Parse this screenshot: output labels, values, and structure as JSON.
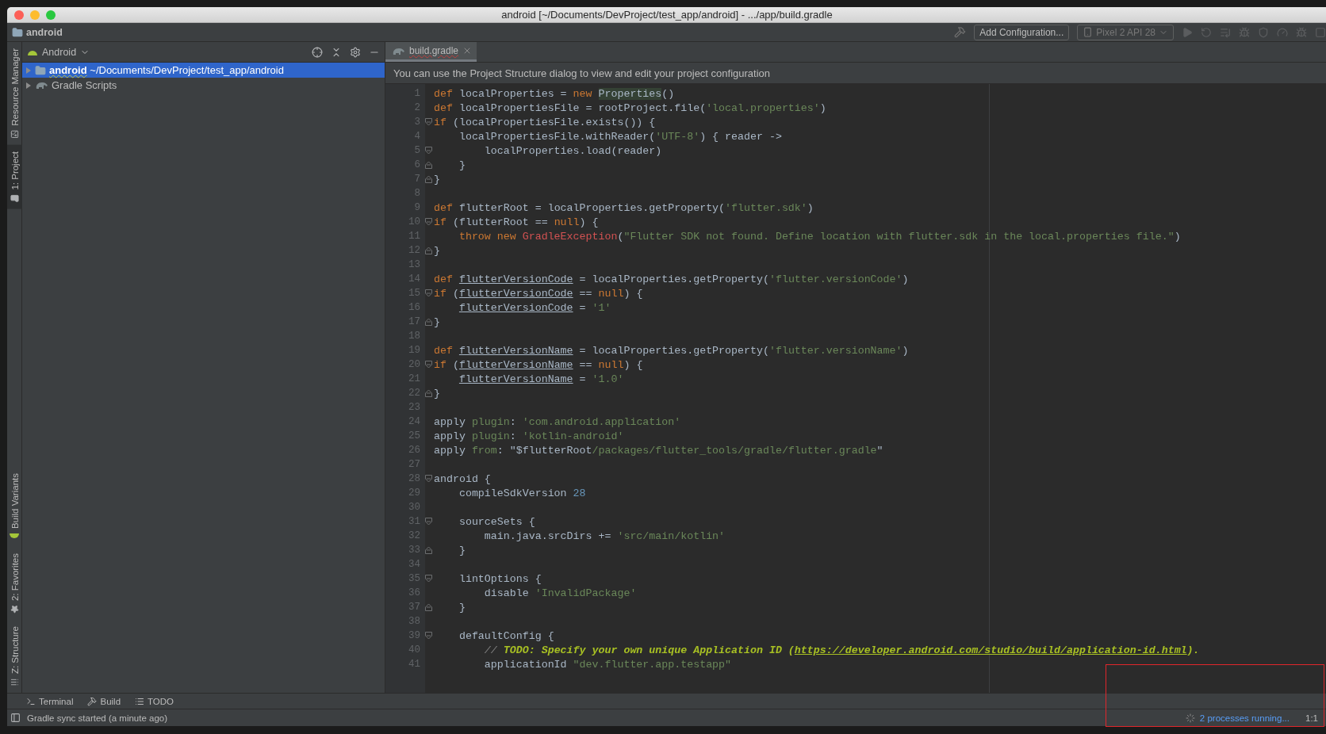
{
  "window": {
    "title": "android [~/Documents/DevProject/test_app/android] - .../app/build.gradle"
  },
  "navbar": {
    "breadcrumb": "android",
    "add_configuration": "Add Configuration...",
    "device": {
      "label": "Pixel 2 API 28",
      "disabled": true
    }
  },
  "tool_strip_top": [
    {
      "label": "Resource Manager",
      "kind": "resources",
      "selected": false
    },
    {
      "label": "1: Project",
      "kind": "project",
      "selected": true
    }
  ],
  "tool_strip_bottom": [
    {
      "label": "Build Variants",
      "kind": "variants",
      "selected": false
    },
    {
      "label": "2: Favorites",
      "kind": "favorites",
      "selected": false
    },
    {
      "label": "Z: Structure",
      "kind": "structure",
      "selected": false
    }
  ],
  "project_panel": {
    "view": "Android",
    "tree": [
      {
        "label": "android",
        "path": "~/Documents/DevProject/test_app/android",
        "kind": "module",
        "selected": true,
        "expanded": false
      },
      {
        "label": "Gradle Scripts",
        "kind": "gradle",
        "selected": false,
        "expanded": false
      }
    ]
  },
  "editor": {
    "tabs": [
      {
        "label": "build.gradle",
        "selected": true
      }
    ],
    "banner": "You can use the Project Structure dialog to view and edit your project configuration",
    "lines": [
      {
        "number": "1",
        "kind": "plain",
        "tokens": [
          {
            "kind": "keyword",
            "text": "def"
          },
          {
            "kind": "plain",
            "text": " localProperties = "
          },
          {
            "kind": "keyword",
            "text": "new "
          },
          {
            "kind": "highlight",
            "text": "Properties"
          },
          {
            "kind": "plain",
            "text": "()"
          }
        ]
      },
      {
        "number": "2",
        "kind": "plain",
        "tokens": [
          {
            "kind": "keyword",
            "text": "def"
          },
          {
            "kind": "plain",
            "text": " localPropertiesFile = rootProject.file("
          },
          {
            "kind": "string",
            "text": "'local.properties'"
          },
          {
            "kind": "plain",
            "text": ")"
          }
        ]
      },
      {
        "number": "3",
        "kind": "fold_open",
        "tokens": [
          {
            "kind": "keyword",
            "text": "if"
          },
          {
            "kind": "plain",
            "text": " (localPropertiesFile.exists()) {"
          }
        ]
      },
      {
        "number": "4",
        "kind": "plain",
        "tokens": [
          {
            "kind": "plain",
            "text": "    localPropertiesFile.withReader("
          },
          {
            "kind": "string",
            "text": "'UTF-8'"
          },
          {
            "kind": "plain",
            "text": ") { reader ->"
          }
        ]
      },
      {
        "number": "5",
        "kind": "fold_open",
        "tokens": [
          {
            "kind": "plain",
            "text": "        localProperties.load(reader)"
          }
        ]
      },
      {
        "number": "6",
        "kind": "fold_close",
        "tokens": [
          {
            "kind": "plain",
            "text": "    }"
          }
        ]
      },
      {
        "number": "7",
        "kind": "fold_close",
        "tokens": [
          {
            "kind": "plain",
            "text": "}"
          }
        ]
      },
      {
        "number": "8",
        "kind": "plain"
      },
      {
        "number": "9",
        "kind": "plain",
        "tokens": [
          {
            "kind": "keyword",
            "text": "def"
          },
          {
            "kind": "plain",
            "text": " flutterRoot = localProperties.getProperty("
          },
          {
            "kind": "string",
            "text": "'flutter.sdk'"
          },
          {
            "kind": "plain",
            "text": ")"
          }
        ]
      },
      {
        "number": "10",
        "kind": "fold_open",
        "tokens": [
          {
            "kind": "keyword",
            "text": "if"
          },
          {
            "kind": "plain",
            "text": " (flutterRoot == "
          },
          {
            "kind": "keyword",
            "text": "null"
          },
          {
            "kind": "plain",
            "text": ") {"
          }
        ]
      },
      {
        "number": "11",
        "kind": "plain",
        "tokens": [
          {
            "kind": "keyword",
            "text": "    throw new "
          },
          {
            "kind": "class",
            "text": "GradleException"
          },
          {
            "kind": "plain",
            "text": "("
          },
          {
            "kind": "string",
            "text": "\"Flutter SDK not found. Define location with flutter.sdk in the local.properties file.\""
          },
          {
            "kind": "plain",
            "text": ")"
          }
        ]
      },
      {
        "number": "12",
        "kind": "fold_close",
        "tokens": [
          {
            "kind": "plain",
            "text": "}"
          }
        ]
      },
      {
        "number": "13",
        "kind": "plain"
      },
      {
        "number": "14",
        "kind": "plain",
        "tokens": [
          {
            "kind": "keyword",
            "text": "def "
          },
          {
            "kind": "underline",
            "text": "flutterVersionCode"
          },
          {
            "kind": "plain",
            "text": " = localProperties.getProperty("
          },
          {
            "kind": "string",
            "text": "'flutter.versionCode'"
          },
          {
            "kind": "plain",
            "text": ")"
          }
        ]
      },
      {
        "number": "15",
        "kind": "fold_open",
        "tokens": [
          {
            "kind": "keyword",
            "text": "if"
          },
          {
            "kind": "plain",
            "text": " ("
          },
          {
            "kind": "underline",
            "text": "flutterVersionCode"
          },
          {
            "kind": "plain",
            "text": " == "
          },
          {
            "kind": "keyword",
            "text": "null"
          },
          {
            "kind": "plain",
            "text": ") {"
          }
        ]
      },
      {
        "number": "16",
        "kind": "plain",
        "tokens": [
          {
            "kind": "underline",
            "text": "    flutterVersionCode"
          },
          {
            "kind": "plain",
            "text": " = "
          },
          {
            "kind": "string",
            "text": "'1'"
          }
        ]
      },
      {
        "number": "17",
        "kind": "fold_close",
        "tokens": [
          {
            "kind": "plain",
            "text": "}"
          }
        ]
      },
      {
        "number": "18",
        "kind": "plain"
      },
      {
        "number": "19",
        "kind": "plain",
        "tokens": [
          {
            "kind": "keyword",
            "text": "def "
          },
          {
            "kind": "underline",
            "text": "flutterVersionName"
          },
          {
            "kind": "plain",
            "text": " = localProperties.getProperty("
          },
          {
            "kind": "string",
            "text": "'flutter.versionName'"
          },
          {
            "kind": "plain",
            "text": ")"
          }
        ]
      },
      {
        "number": "20",
        "kind": "fold_open",
        "tokens": [
          {
            "kind": "keyword",
            "text": "if"
          },
          {
            "kind": "plain",
            "text": " ("
          },
          {
            "kind": "underline",
            "text": "flutterVersionName"
          },
          {
            "kind": "plain",
            "text": " == "
          },
          {
            "kind": "keyword",
            "text": "null"
          },
          {
            "kind": "plain",
            "text": ") {"
          }
        ]
      },
      {
        "number": "21",
        "kind": "plain",
        "tokens": [
          {
            "kind": "underline",
            "text": "    flutterVersionName"
          },
          {
            "kind": "plain",
            "text": " = "
          },
          {
            "kind": "string",
            "text": "'1.0'"
          }
        ]
      },
      {
        "number": "22",
        "kind": "fold_close",
        "tokens": [
          {
            "kind": "plain",
            "text": "}"
          }
        ]
      },
      {
        "number": "23",
        "kind": "plain"
      },
      {
        "number": "24",
        "kind": "plain",
        "tokens": [
          {
            "kind": "plain",
            "text": "apply "
          },
          {
            "kind": "named_arg",
            "text": "plugin"
          },
          {
            "kind": "plain",
            "text": ": "
          },
          {
            "kind": "string",
            "text": "'com.android.application'"
          }
        ]
      },
      {
        "number": "25",
        "kind": "plain",
        "tokens": [
          {
            "kind": "plain",
            "text": "apply "
          },
          {
            "kind": "named_arg",
            "text": "plugin"
          },
          {
            "kind": "plain",
            "text": ": "
          },
          {
            "kind": "string",
            "text": "'kotlin-android'"
          }
        ]
      },
      {
        "number": "26",
        "kind": "plain",
        "tokens": [
          {
            "kind": "plain",
            "text": "apply "
          },
          {
            "kind": "named_arg",
            "text": "from"
          },
          {
            "kind": "plain",
            "text": ": \"$flutterRoot"
          },
          {
            "kind": "string",
            "text": "/packages/flutter_tools/gradle/flutter.gradle"
          },
          {
            "kind": "plain",
            "text": "\""
          }
        ]
      },
      {
        "number": "27",
        "kind": "plain"
      },
      {
        "number": "28",
        "kind": "fold_open",
        "tokens": [
          {
            "kind": "plain",
            "text": "android {"
          }
        ]
      },
      {
        "number": "29",
        "kind": "plain",
        "tokens": [
          {
            "kind": "plain",
            "text": "    compileSdkVersion "
          },
          {
            "kind": "number",
            "text": "28"
          }
        ]
      },
      {
        "number": "30",
        "kind": "plain"
      },
      {
        "number": "31",
        "kind": "fold_open",
        "tokens": [
          {
            "kind": "plain",
            "text": "    sourceSets {"
          }
        ]
      },
      {
        "number": "32",
        "kind": "plain",
        "tokens": [
          {
            "kind": "plain",
            "text": "        main.java.srcDirs += "
          },
          {
            "kind": "string",
            "text": "'src/main/kotlin'"
          }
        ]
      },
      {
        "number": "33",
        "kind": "fold_close",
        "tokens": [
          {
            "kind": "plain",
            "text": "    }"
          }
        ]
      },
      {
        "number": "34",
        "kind": "plain"
      },
      {
        "number": "35",
        "kind": "fold_open",
        "tokens": [
          {
            "kind": "plain",
            "text": "    lintOptions {"
          }
        ]
      },
      {
        "number": "36",
        "kind": "plain",
        "tokens": [
          {
            "kind": "plain",
            "text": "        disable "
          },
          {
            "kind": "string",
            "text": "'InvalidPackage'"
          }
        ]
      },
      {
        "number": "37",
        "kind": "fold_close",
        "tokens": [
          {
            "kind": "plain",
            "text": "    }"
          }
        ]
      },
      {
        "number": "38",
        "kind": "plain"
      },
      {
        "number": "39",
        "kind": "fold_open",
        "tokens": [
          {
            "kind": "plain",
            "text": "    defaultConfig {"
          }
        ]
      },
      {
        "number": "40",
        "kind": "plain",
        "tokens": [
          {
            "kind": "comment",
            "text": "        // "
          },
          {
            "kind": "todo",
            "text": "TODO: Specify your own unique Application ID ("
          },
          {
            "kind": "link",
            "text": "https://developer.android.com/studio/build/application-id.html"
          },
          {
            "kind": "todo",
            "text": ")."
          }
        ]
      },
      {
        "number": "41",
        "kind": "plain",
        "tokens": [
          {
            "kind": "plain",
            "text": "        applicationId "
          },
          {
            "kind": "string",
            "text": "\"dev.flutter.app.testapp\""
          }
        ]
      }
    ]
  },
  "bottom_tabs": [
    {
      "label": "Terminal",
      "kind": "terminal"
    },
    {
      "label": "Build",
      "kind": "build"
    },
    {
      "label": "TODO",
      "kind": "todo"
    }
  ],
  "status_bar": {
    "message": "Gradle sync started (a minute ago)",
    "processes": "2 processes running...",
    "position": "1:1"
  }
}
